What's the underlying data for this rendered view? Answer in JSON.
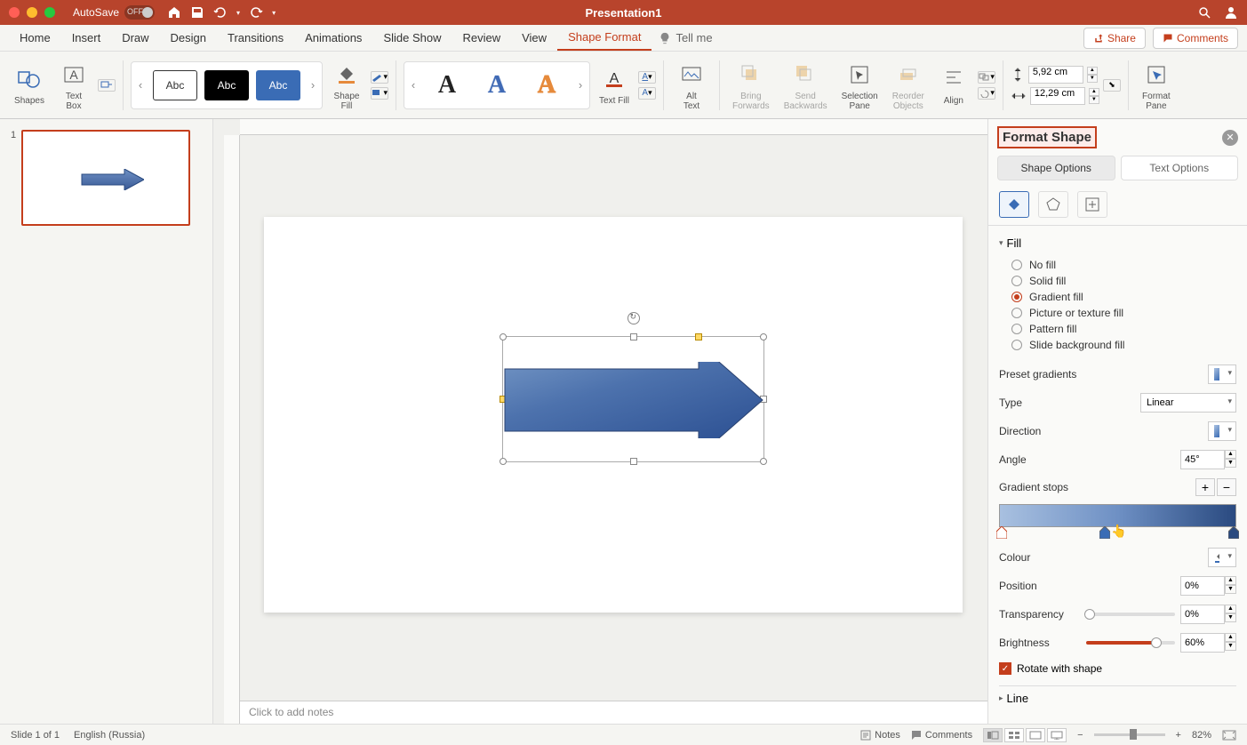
{
  "titlebar": {
    "autosave_label": "AutoSave",
    "autosave_state": "OFF",
    "doc_title": "Presentation1"
  },
  "tabs": {
    "home": "Home",
    "insert": "Insert",
    "draw": "Draw",
    "design": "Design",
    "transitions": "Transitions",
    "animations": "Animations",
    "slideshow": "Slide Show",
    "review": "Review",
    "view": "View",
    "shapeformat": "Shape Format",
    "tellme": "Tell me"
  },
  "ribbon_right": {
    "share": "Share",
    "comments": "Comments"
  },
  "ribbon": {
    "shapes": "Shapes",
    "textbox": "Text\nBox",
    "style_abc": "Abc",
    "shape_fill": "Shape\nFill",
    "wordart_a": "A",
    "text_fill": "Text Fill",
    "alt_text": "Alt\nText",
    "bring_forwards": "Bring\nForwards",
    "send_backwards": "Send\nBackwards",
    "selection_pane": "Selection\nPane",
    "reorder_objects": "Reorder\nObjects",
    "align": "Align",
    "height": "5,92 cm",
    "width": "12,29 cm",
    "format_pane": "Format\nPane"
  },
  "slides": {
    "num1": "1"
  },
  "notes_placeholder": "Click to add notes",
  "format_pane": {
    "title": "Format Shape",
    "tab_shape": "Shape Options",
    "tab_text": "Text Options",
    "section_fill": "Fill",
    "fill_opts": {
      "none": "No fill",
      "solid": "Solid fill",
      "gradient": "Gradient fill",
      "picture": "Picture or texture fill",
      "pattern": "Pattern fill",
      "slide_bg": "Slide background fill"
    },
    "preset": "Preset gradients",
    "type": "Type",
    "type_val": "Linear",
    "direction": "Direction",
    "angle": "Angle",
    "angle_val": "45°",
    "gradient_stops": "Gradient stops",
    "colour": "Colour",
    "position": "Position",
    "position_val": "0%",
    "transparency": "Transparency",
    "transparency_val": "0%",
    "brightness": "Brightness",
    "brightness_val": "60%",
    "rotate": "Rotate with shape",
    "section_line": "Line"
  },
  "statusbar": {
    "slide": "Slide 1 of 1",
    "lang": "English (Russia)",
    "notes": "Notes",
    "comments": "Comments",
    "zoom": "82%"
  }
}
